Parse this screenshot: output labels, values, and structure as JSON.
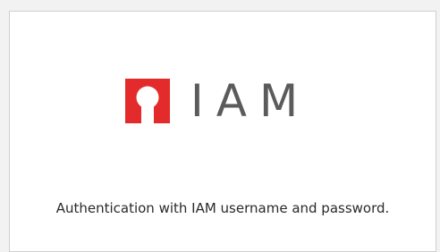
{
  "logo": {
    "icon": "iam-logo-mark",
    "text": "IAM",
    "brand_color": "#e32b2b",
    "text_color": "#5b5b5b"
  },
  "description": "Authentication with IAM username and password."
}
